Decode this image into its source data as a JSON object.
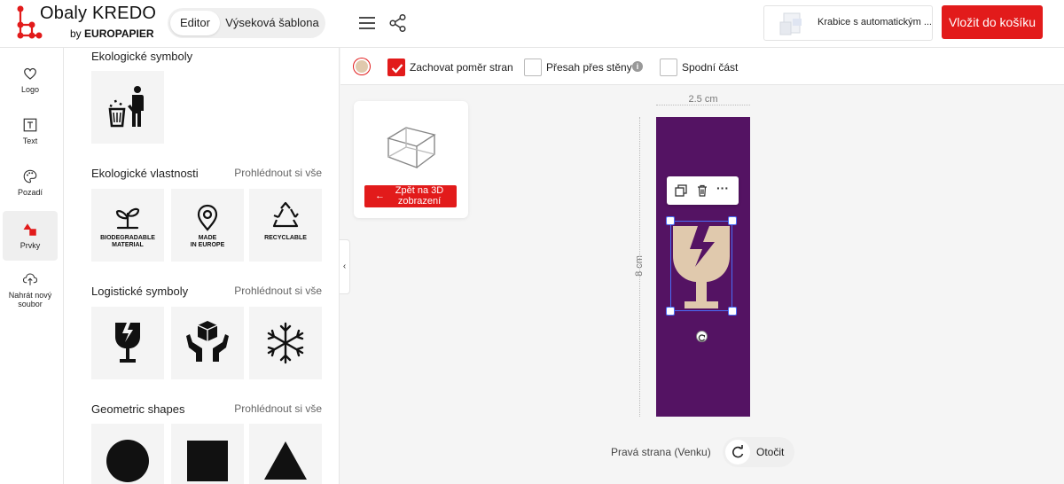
{
  "header": {
    "logo_title": "Obaly KREDO",
    "logo_by": "by",
    "logo_brand": "EUROPAPIER",
    "mode_tabs": [
      "Editor",
      "Výseková šablona"
    ],
    "product_name": "Krabice s automatickým ...",
    "cart_button": "Vložit do košíku"
  },
  "rail": {
    "items": [
      {
        "label": "Logo",
        "icon": "heart-icon"
      },
      {
        "label": "Text",
        "icon": "text-icon"
      },
      {
        "label": "Pozadí",
        "icon": "palette-icon"
      },
      {
        "label": "Prvky",
        "icon": "shapes-icon"
      },
      {
        "label": "Nahrát nový soubor",
        "icon": "upload-icon"
      }
    ]
  },
  "panel": {
    "sections": [
      {
        "title": "Ekologické symboly",
        "link": ""
      },
      {
        "title": "Ekologické vlastnosti",
        "link": "Prohlédnout si vše"
      },
      {
        "title": "Logistické symboly",
        "link": "Prohlédnout si vše"
      },
      {
        "title": "Geometric shapes",
        "link": "Prohlédnout si vše"
      }
    ],
    "eco_labels": [
      [
        "BIODEGRADABLE",
        "MATERIAL"
      ],
      [
        "MADE",
        "IN EUROPE"
      ],
      [
        "RECYCLABLE",
        ""
      ]
    ]
  },
  "toolbar": {
    "keep_ratio": "Zachovat poměr stran",
    "overlap": "Přesah přes stěny",
    "bottom": "Spodní část",
    "info": "i"
  },
  "preview": {
    "back_arrow": "←",
    "back_line1": "Zpět na 3D",
    "back_line2": "zobrazení"
  },
  "canvas": {
    "width_label": "2.5 cm",
    "height_label": "8 cm",
    "side_label": "Pravá strana (Venku)",
    "rotate_label": "Otočit",
    "ctx_more": "···"
  },
  "colors": {
    "accent": "#e21b1b",
    "face": "#541363",
    "glass": "#e0c9ad",
    "selection": "#4a6cf7"
  }
}
